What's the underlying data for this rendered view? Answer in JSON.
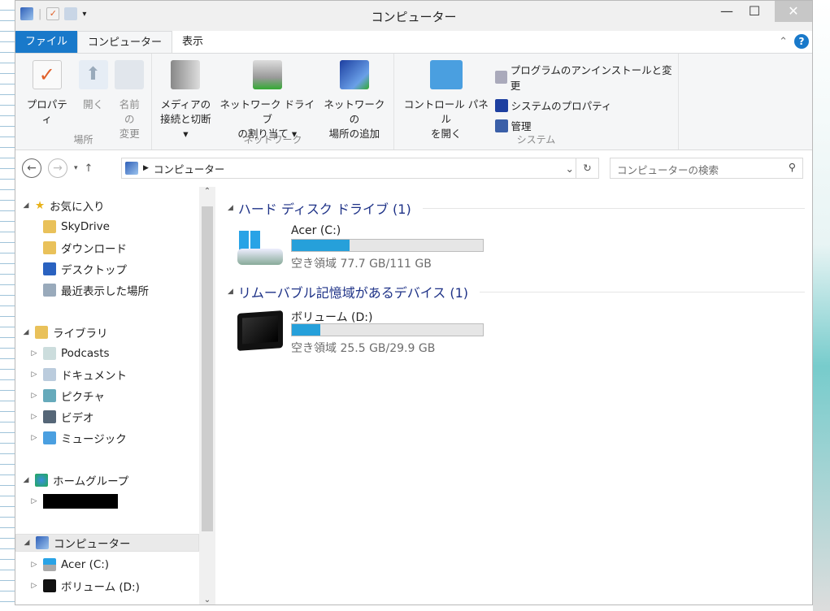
{
  "window": {
    "title": "コンピューター",
    "minimize": "—",
    "maximize": "☐",
    "close": "✕"
  },
  "tabs": [
    {
      "label": "ファイル"
    },
    {
      "label": "コンピューター"
    },
    {
      "label": "表示"
    }
  ],
  "ribbon": {
    "location": {
      "label": "場所",
      "buttons": [
        {
          "label1": "プロパティ",
          "label2": ""
        },
        {
          "label1": "開く",
          "label2": ""
        },
        {
          "label1": "名前の",
          "label2": "変更"
        }
      ]
    },
    "network": {
      "label": "ネットワーク",
      "buttons": [
        {
          "label1": "メディアの",
          "label2": "接続と切断 ▾"
        },
        {
          "label1": "ネットワーク ドライブ",
          "label2": "の割り当て ▾"
        },
        {
          "label1": "ネットワークの",
          "label2": "場所の追加"
        }
      ]
    },
    "system": {
      "label": "システム",
      "control_panel1": "コントロール パネル",
      "control_panel2": "を開く",
      "items": [
        "プログラムのアンインストールと変更",
        "システムのプロパティ",
        "管理"
      ]
    }
  },
  "address": {
    "path": "コンピューター",
    "search_placeholder": "コンピューターの検索"
  },
  "nav": {
    "favorites": "お気に入り",
    "fav_items": [
      "SkyDrive",
      "ダウンロード",
      "デスクトップ",
      "最近表示した場所"
    ],
    "libraries": "ライブラリ",
    "lib_items": [
      "Podcasts",
      "ドキュメント",
      "ピクチャ",
      "ビデオ",
      "ミュージック"
    ],
    "homegroup": "ホームグループ",
    "computer": "コンピューター",
    "comp_items": [
      "Acer (C:)",
      "ボリューム (D:)"
    ]
  },
  "groups": [
    {
      "title": "ハード ディスク ドライブ (1)",
      "drive": {
        "name": "Acer (C:)",
        "free": "空き領域 77.7 GB/111 GB",
        "used_fraction": 0.3
      }
    },
    {
      "title": "リムーバブル記憶域があるデバイス (1)",
      "drive": {
        "name": "ボリューム (D:)",
        "free": "空き領域 25.5 GB/29.9 GB",
        "used_fraction": 0.147
      }
    }
  ],
  "colors": {
    "accent": "#1979ca",
    "bar": "#26a0da"
  }
}
